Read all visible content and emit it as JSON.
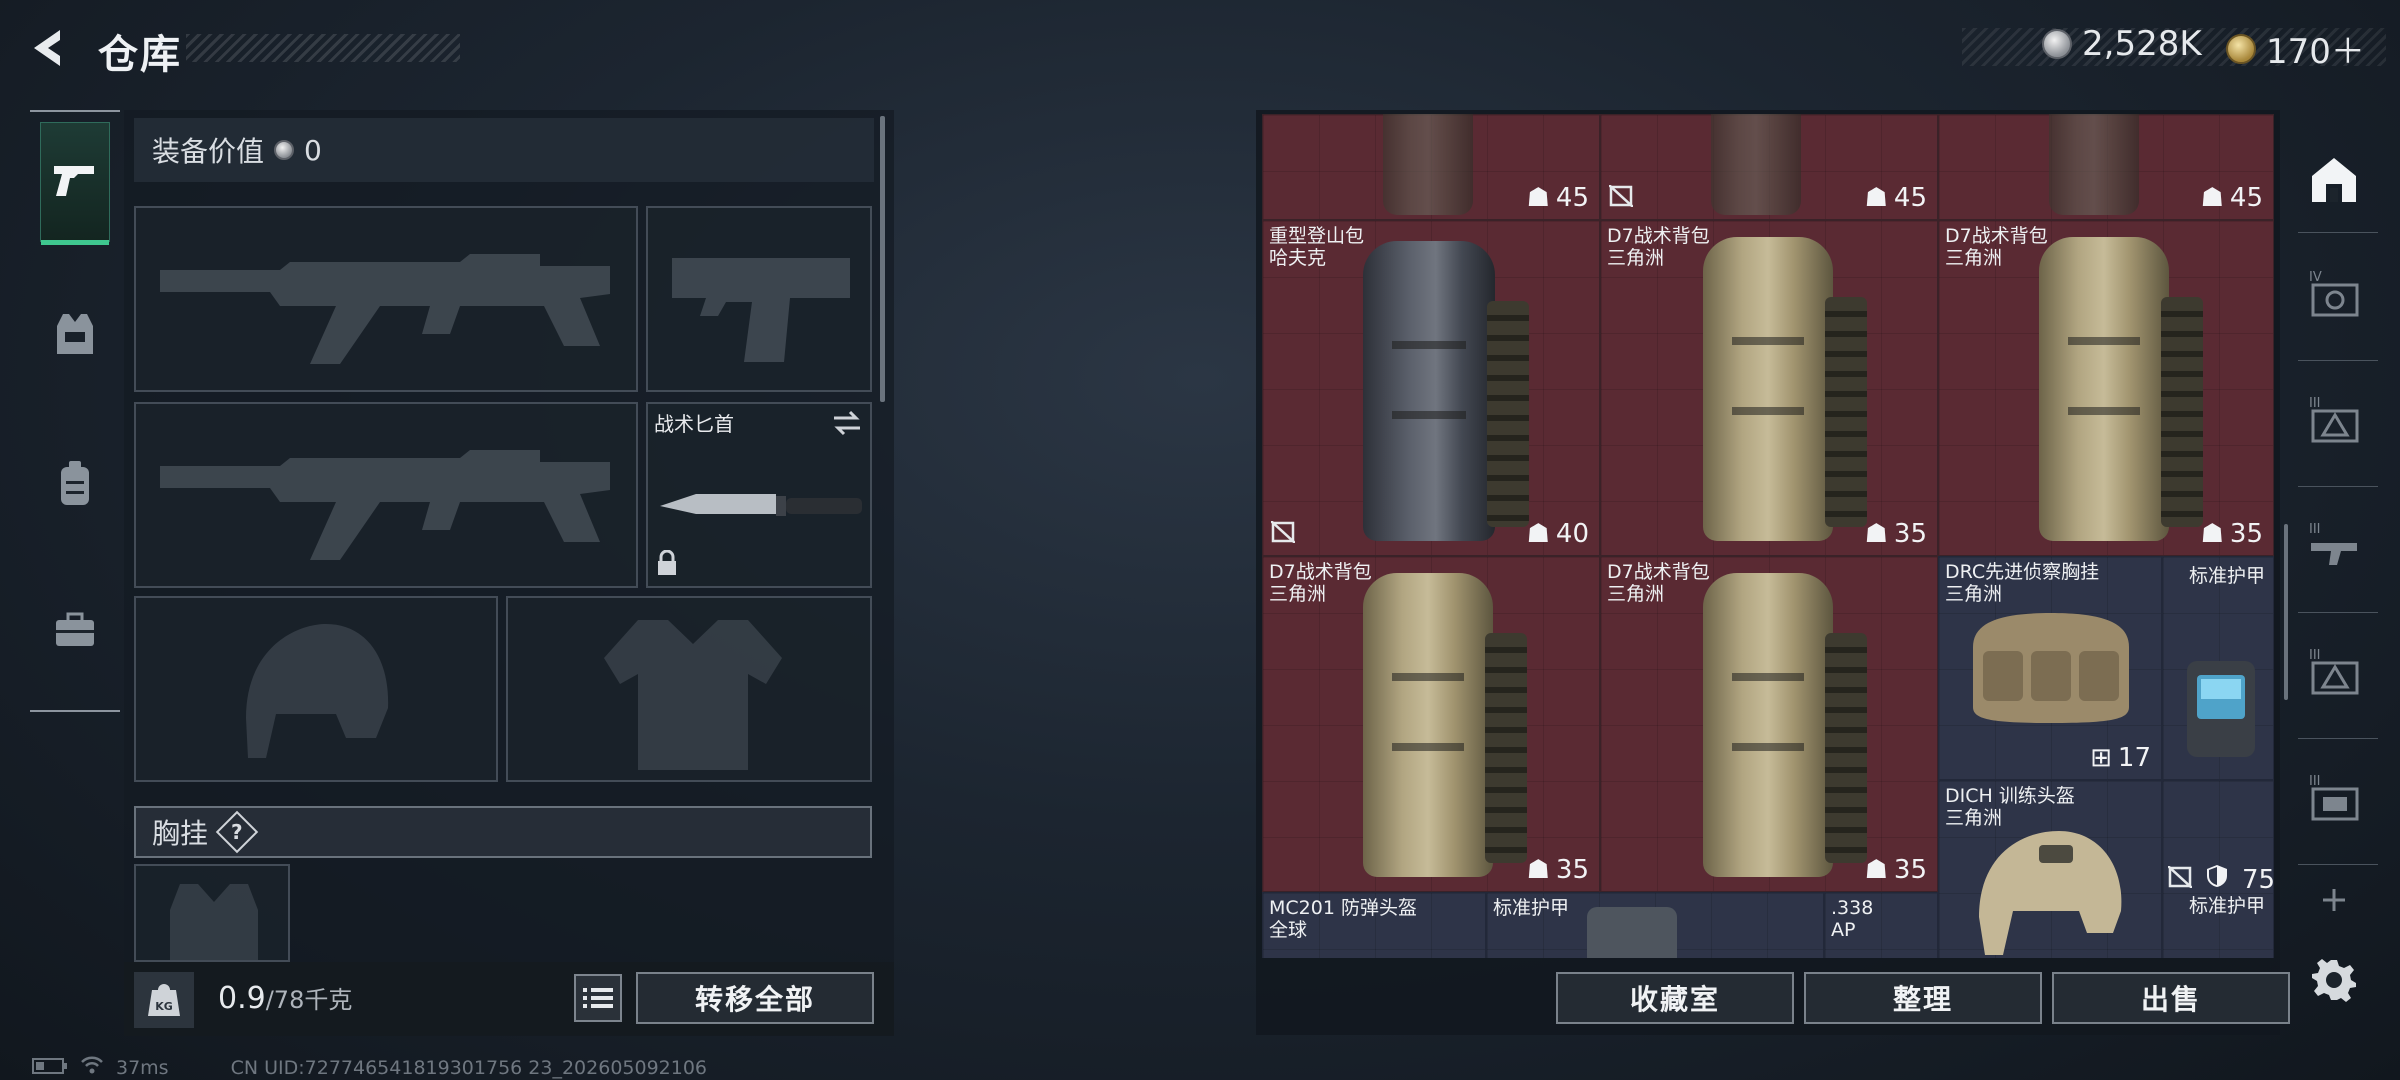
{
  "header": {
    "title": "仓库",
    "currencies": [
      {
        "icon": "silver-coin-icon",
        "value": "2,528K"
      },
      {
        "icon": "gold-coin-icon",
        "value": "170＋"
      }
    ]
  },
  "left_rail": {
    "tabs": [
      {
        "icon": "pistol-icon",
        "active": true
      },
      {
        "icon": "vest-icon",
        "active": false
      },
      {
        "icon": "backpack-icon",
        "active": false
      },
      {
        "icon": "toolbox-icon",
        "active": false
      }
    ]
  },
  "equipment": {
    "value_label": "装备价值",
    "value": "0",
    "knife_label": "战术匕首",
    "chest_rig_section": "胸挂",
    "help": "?"
  },
  "weight": {
    "icon_text": "KG",
    "current": "0.9",
    "capacity": "/78千克"
  },
  "buttons": {
    "transfer_all": "转移全部",
    "collection": "收藏室",
    "organize": "整理",
    "sell": "出售"
  },
  "stash": {
    "top_row": [
      {
        "capacity": "45",
        "no_sell": false
      },
      {
        "capacity": "45",
        "no_sell": true
      },
      {
        "capacity": "45",
        "no_sell": false
      }
    ],
    "row1": [
      {
        "name": "重型登山包",
        "sub": "哈夫克",
        "capacity": "40",
        "no_sell": true,
        "style": "grey"
      },
      {
        "name": "D7战术背包",
        "sub": "三角洲",
        "capacity": "35",
        "no_sell": false,
        "style": "tan"
      },
      {
        "name": "D7战术背包",
        "sub": "三角洲",
        "capacity": "35",
        "no_sell": false,
        "style": "tan"
      }
    ],
    "row2": [
      {
        "name": "D7战术背包",
        "sub": "三角洲",
        "capacity": "35",
        "style": "tan"
      },
      {
        "name": "D7战术背包",
        "sub": "三角洲",
        "capacity": "35",
        "style": "tan"
      }
    ],
    "rig": {
      "name": "DRC先进侦察胸挂",
      "sub": "三角洲",
      "capacity": "17"
    },
    "armor_label": "标准护甲",
    "helmet": {
      "name": "DICH 训练头盔",
      "sub": "三角洲",
      "durability": "75"
    },
    "armor_label_2": "标准护甲",
    "bottom": [
      {
        "name": "MC201 防弹头盔",
        "sub": "全球"
      },
      {
        "name": "标准护甲"
      },
      {
        "name": ".338",
        "sub": "AP"
      }
    ]
  },
  "right_rail": [
    {
      "icon": "stash-home-icon",
      "label": ""
    },
    {
      "icon": "tier-iv-item-icon",
      "label": "IV"
    },
    {
      "icon": "tier-iii-triangle-icon",
      "label": "III"
    },
    {
      "icon": "tier-iii-gun-icon",
      "label": "III"
    },
    {
      "icon": "tier-iii-triangle-icon",
      "label": "III"
    },
    {
      "icon": "tier-iii-item-icon",
      "label": "III"
    }
  ],
  "status": {
    "ping": "37ms",
    "uid": "CN UID:727746541819301756 23_202605092106"
  }
}
